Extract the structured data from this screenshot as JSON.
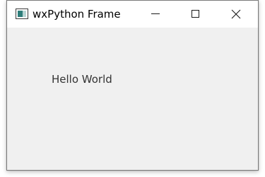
{
  "window": {
    "title": "wxPython Frame",
    "icon": "wxpython-app-icon",
    "caption_buttons": {
      "minimize": "minimize-icon",
      "maximize": "maximize-icon",
      "close": "close-icon"
    }
  },
  "content": {
    "label": "Hello World"
  },
  "colors": {
    "titlebar": "#ffffff",
    "client_background": "#f0f0f0",
    "text": "#333333"
  }
}
